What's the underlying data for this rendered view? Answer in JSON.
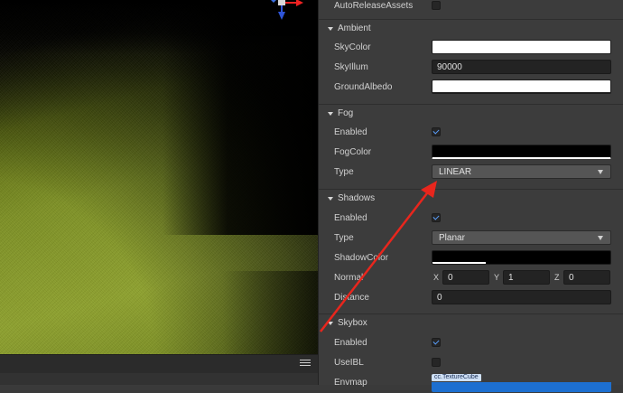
{
  "inspector": {
    "auto_release": {
      "label": "AutoReleaseAssets",
      "checked": false
    },
    "ambient": {
      "title": "Ambient",
      "sky_color": {
        "label": "SkyColor",
        "color": "#ffffff"
      },
      "sky_illum": {
        "label": "SkyIllum",
        "value": "90000"
      },
      "ground_albedo": {
        "label": "GroundAlbedo",
        "color": "#ffffff"
      }
    },
    "fog": {
      "title": "Fog",
      "enabled": {
        "label": "Enabled",
        "checked": true
      },
      "fog_color": {
        "label": "FogColor",
        "color": "#000000"
      },
      "type": {
        "label": "Type",
        "value": "LINEAR"
      }
    },
    "shadows": {
      "title": "Shadows",
      "enabled": {
        "label": "Enabled",
        "checked": true
      },
      "type": {
        "label": "Type",
        "value": "Planar"
      },
      "shadow_color": {
        "label": "ShadowColor",
        "color": "#000000",
        "alpha_fraction": 0.3
      },
      "normal": {
        "label": "Normal",
        "x_label": "X",
        "x": "0",
        "y_label": "Y",
        "y": "1",
        "z_label": "Z",
        "z": "0"
      },
      "distance": {
        "label": "Distance",
        "value": "0"
      }
    },
    "skybox": {
      "title": "Skybox",
      "enabled": {
        "label": "Enabled",
        "checked": true
      },
      "use_ibl": {
        "label": "UseIBL",
        "checked": false
      },
      "envmap": {
        "label": "Envmap",
        "asset_type": "cc.TextureCube"
      }
    }
  },
  "colors": {
    "accent": "#1d6fd0",
    "annotation_arrow": "#e8261d",
    "check": "#5aa0ff"
  },
  "icons": {
    "scene_menu": "hamburger-menu-icon",
    "gizmo": "axis-gizmo-icon"
  }
}
